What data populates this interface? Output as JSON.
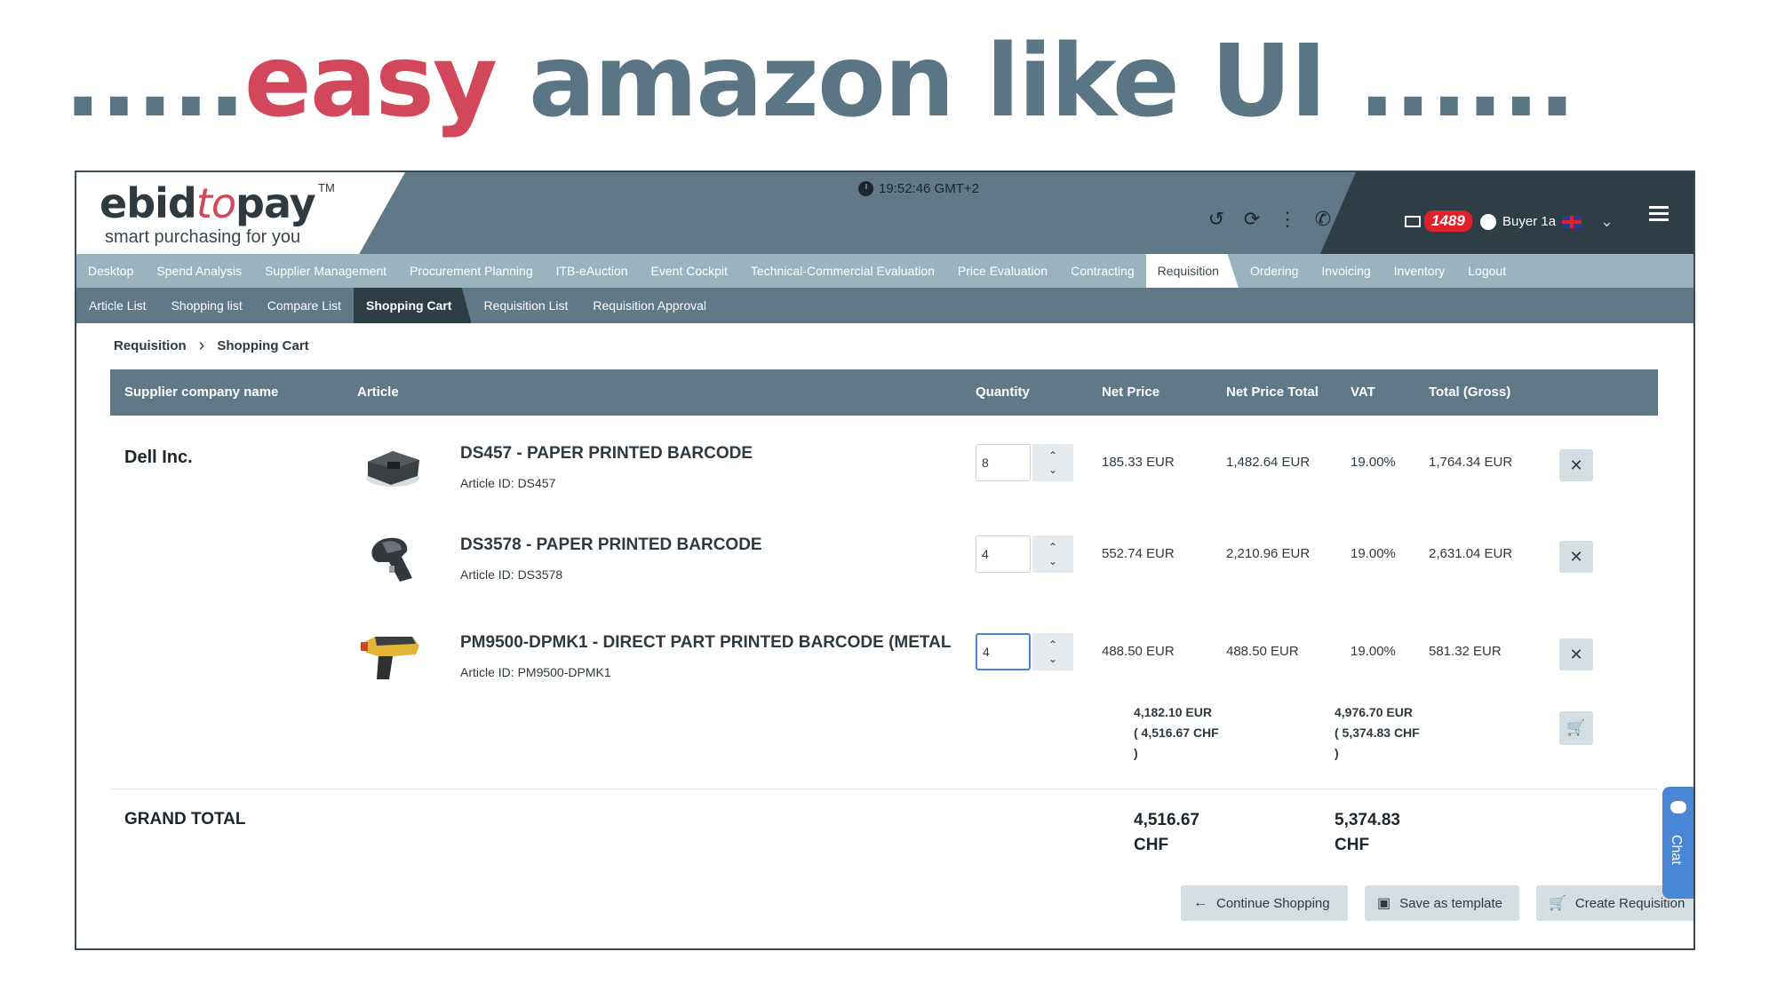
{
  "slide": {
    "prefix": ".....",
    "accent": "easy",
    "rest": " amazon like UI ......"
  },
  "header": {
    "logo_main_a": "ebid",
    "logo_main_b": "to",
    "logo_main_c": "pay",
    "logo_tm": "TM",
    "logo_sub": "smart purchasing for you",
    "time": "19:52:46 GMT+2",
    "mail_count": "1489",
    "user": "Buyer 1a"
  },
  "main_nav": [
    {
      "label": "Desktop"
    },
    {
      "label": "Spend Analysis"
    },
    {
      "label": "Supplier Management"
    },
    {
      "label": "Procurement Planning"
    },
    {
      "label": "ITB-eAuction"
    },
    {
      "label": "Event Cockpit"
    },
    {
      "label": "Technical-Commercial Evaluation"
    },
    {
      "label": "Price Evaluation"
    },
    {
      "label": "Contracting"
    },
    {
      "label": "Requisition"
    },
    {
      "label": "Ordering"
    },
    {
      "label": "Invoicing"
    },
    {
      "label": "Inventory"
    },
    {
      "label": "Logout"
    }
  ],
  "sub_nav": [
    {
      "label": "Article List"
    },
    {
      "label": "Shopping list"
    },
    {
      "label": "Compare List"
    },
    {
      "label": "Shopping Cart"
    },
    {
      "label": "Requisition List"
    },
    {
      "label": "Requisition Approval"
    }
  ],
  "breadcrumb": {
    "parent": "Requisition",
    "current": "Shopping Cart"
  },
  "table": {
    "headers": {
      "supplier": "Supplier company name",
      "article": "Article",
      "quantity": "Quantity",
      "net_price": "Net Price",
      "net_total": "Net Price Total",
      "vat": "VAT",
      "gross": "Total (Gross)"
    },
    "supplier": "Dell Inc.",
    "rows": [
      {
        "title": "DS457 - PAPER PRINTED BARCODE",
        "article_id": "Article ID: DS457",
        "qty": "8",
        "net_price": "185.33 EUR",
        "net_total": "1,482.64 EUR",
        "vat": "19.00%",
        "gross": "1,764.34 EUR"
      },
      {
        "title": "DS3578 - PAPER PRINTED BARCODE",
        "article_id": "Article ID: DS3578",
        "qty": "4",
        "net_price": "552.74 EUR",
        "net_total": "2,210.96 EUR",
        "vat": "19.00%",
        "gross": "2,631.04 EUR"
      },
      {
        "title": "PM9500-DPMK1 - DIRECT PART PRINTED BARCODE (METAL",
        "article_id": "Article ID: PM9500-DPMK1",
        "qty": "4",
        "net_price": "488.50 EUR",
        "net_total": "488.50 EUR",
        "vat": "19.00%",
        "gross": "581.32 EUR"
      }
    ],
    "subtotal": {
      "net_1": "4,182.10 EUR",
      "net_2": "( 4,516.67 CHF",
      "net_3": ")",
      "gross_1": "4,976.70 EUR",
      "gross_2": "( 5,374.83 CHF",
      "gross_3": ")"
    }
  },
  "grand_total": {
    "label": "GRAND TOTAL",
    "net_1": "4,516.67",
    "net_2": "CHF",
    "gross_1": "5,374.83",
    "gross_2": "CHF"
  },
  "actions": {
    "continue": "Continue Shopping",
    "template": "Save as template",
    "create": "Create Requisition"
  },
  "chat": "Chat"
}
